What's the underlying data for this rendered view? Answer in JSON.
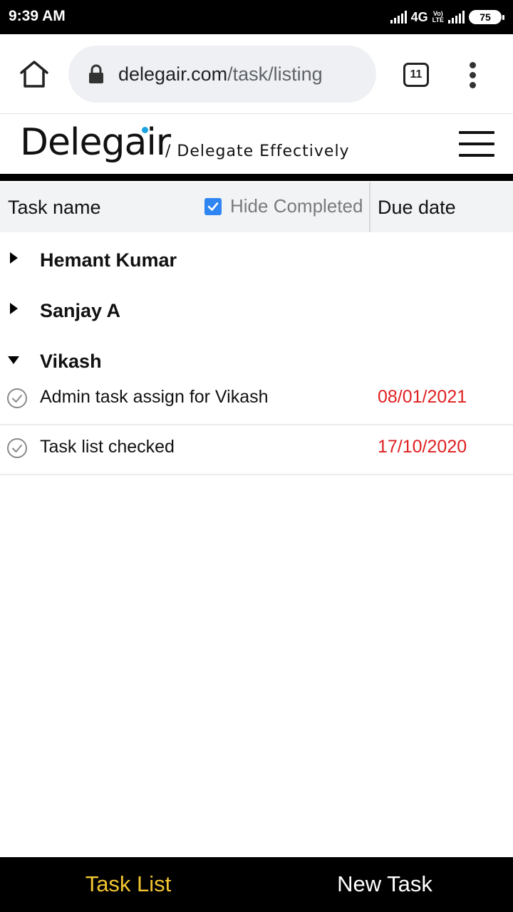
{
  "status_bar": {
    "time": "9:39 AM",
    "network": "4G",
    "volte_top": "Vo)",
    "volte_bottom": "LTE",
    "battery": "75"
  },
  "browser": {
    "url_domain": "delegair.com",
    "url_path": "/task/listing",
    "tab_count": "11"
  },
  "app": {
    "logo": "Delegair",
    "tagline": "/ Delegate Effectively"
  },
  "table_header": {
    "task_name": "Task name",
    "hide_completed": "Hide Completed",
    "hide_completed_checked": true,
    "due_date": "Due date"
  },
  "groups": [
    {
      "name": "Hemant Kumar",
      "expanded": false,
      "tasks": []
    },
    {
      "name": "Sanjay A",
      "expanded": false,
      "tasks": []
    },
    {
      "name": "Vikash",
      "expanded": true,
      "tasks": [
        {
          "name": "Admin task assign for Vikash",
          "due": "08/01/2021"
        },
        {
          "name": "Task list checked",
          "due": "17/10/2020"
        }
      ]
    }
  ],
  "bottom_nav": {
    "task_list": "Task List",
    "new_task": "New Task"
  },
  "colors": {
    "accent_yellow": "#f2c531",
    "due_red": "#e02020",
    "checkbox_blue": "#2f86f2",
    "logo_dot": "#1aa3e0"
  }
}
